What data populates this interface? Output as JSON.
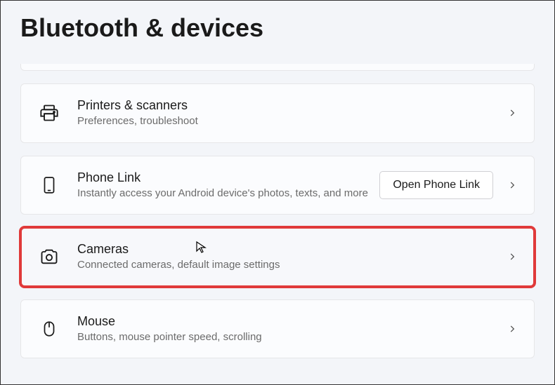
{
  "page_title": "Bluetooth & devices",
  "rows": {
    "printers": {
      "title": "Printers & scanners",
      "subtitle": "Preferences, troubleshoot"
    },
    "phonelink": {
      "title": "Phone Link",
      "subtitle": "Instantly access your Android device's photos, texts, and more",
      "button": "Open Phone Link"
    },
    "cameras": {
      "title": "Cameras",
      "subtitle": "Connected cameras, default image settings"
    },
    "mouse": {
      "title": "Mouse",
      "subtitle": "Buttons, mouse pointer speed, scrolling"
    }
  }
}
